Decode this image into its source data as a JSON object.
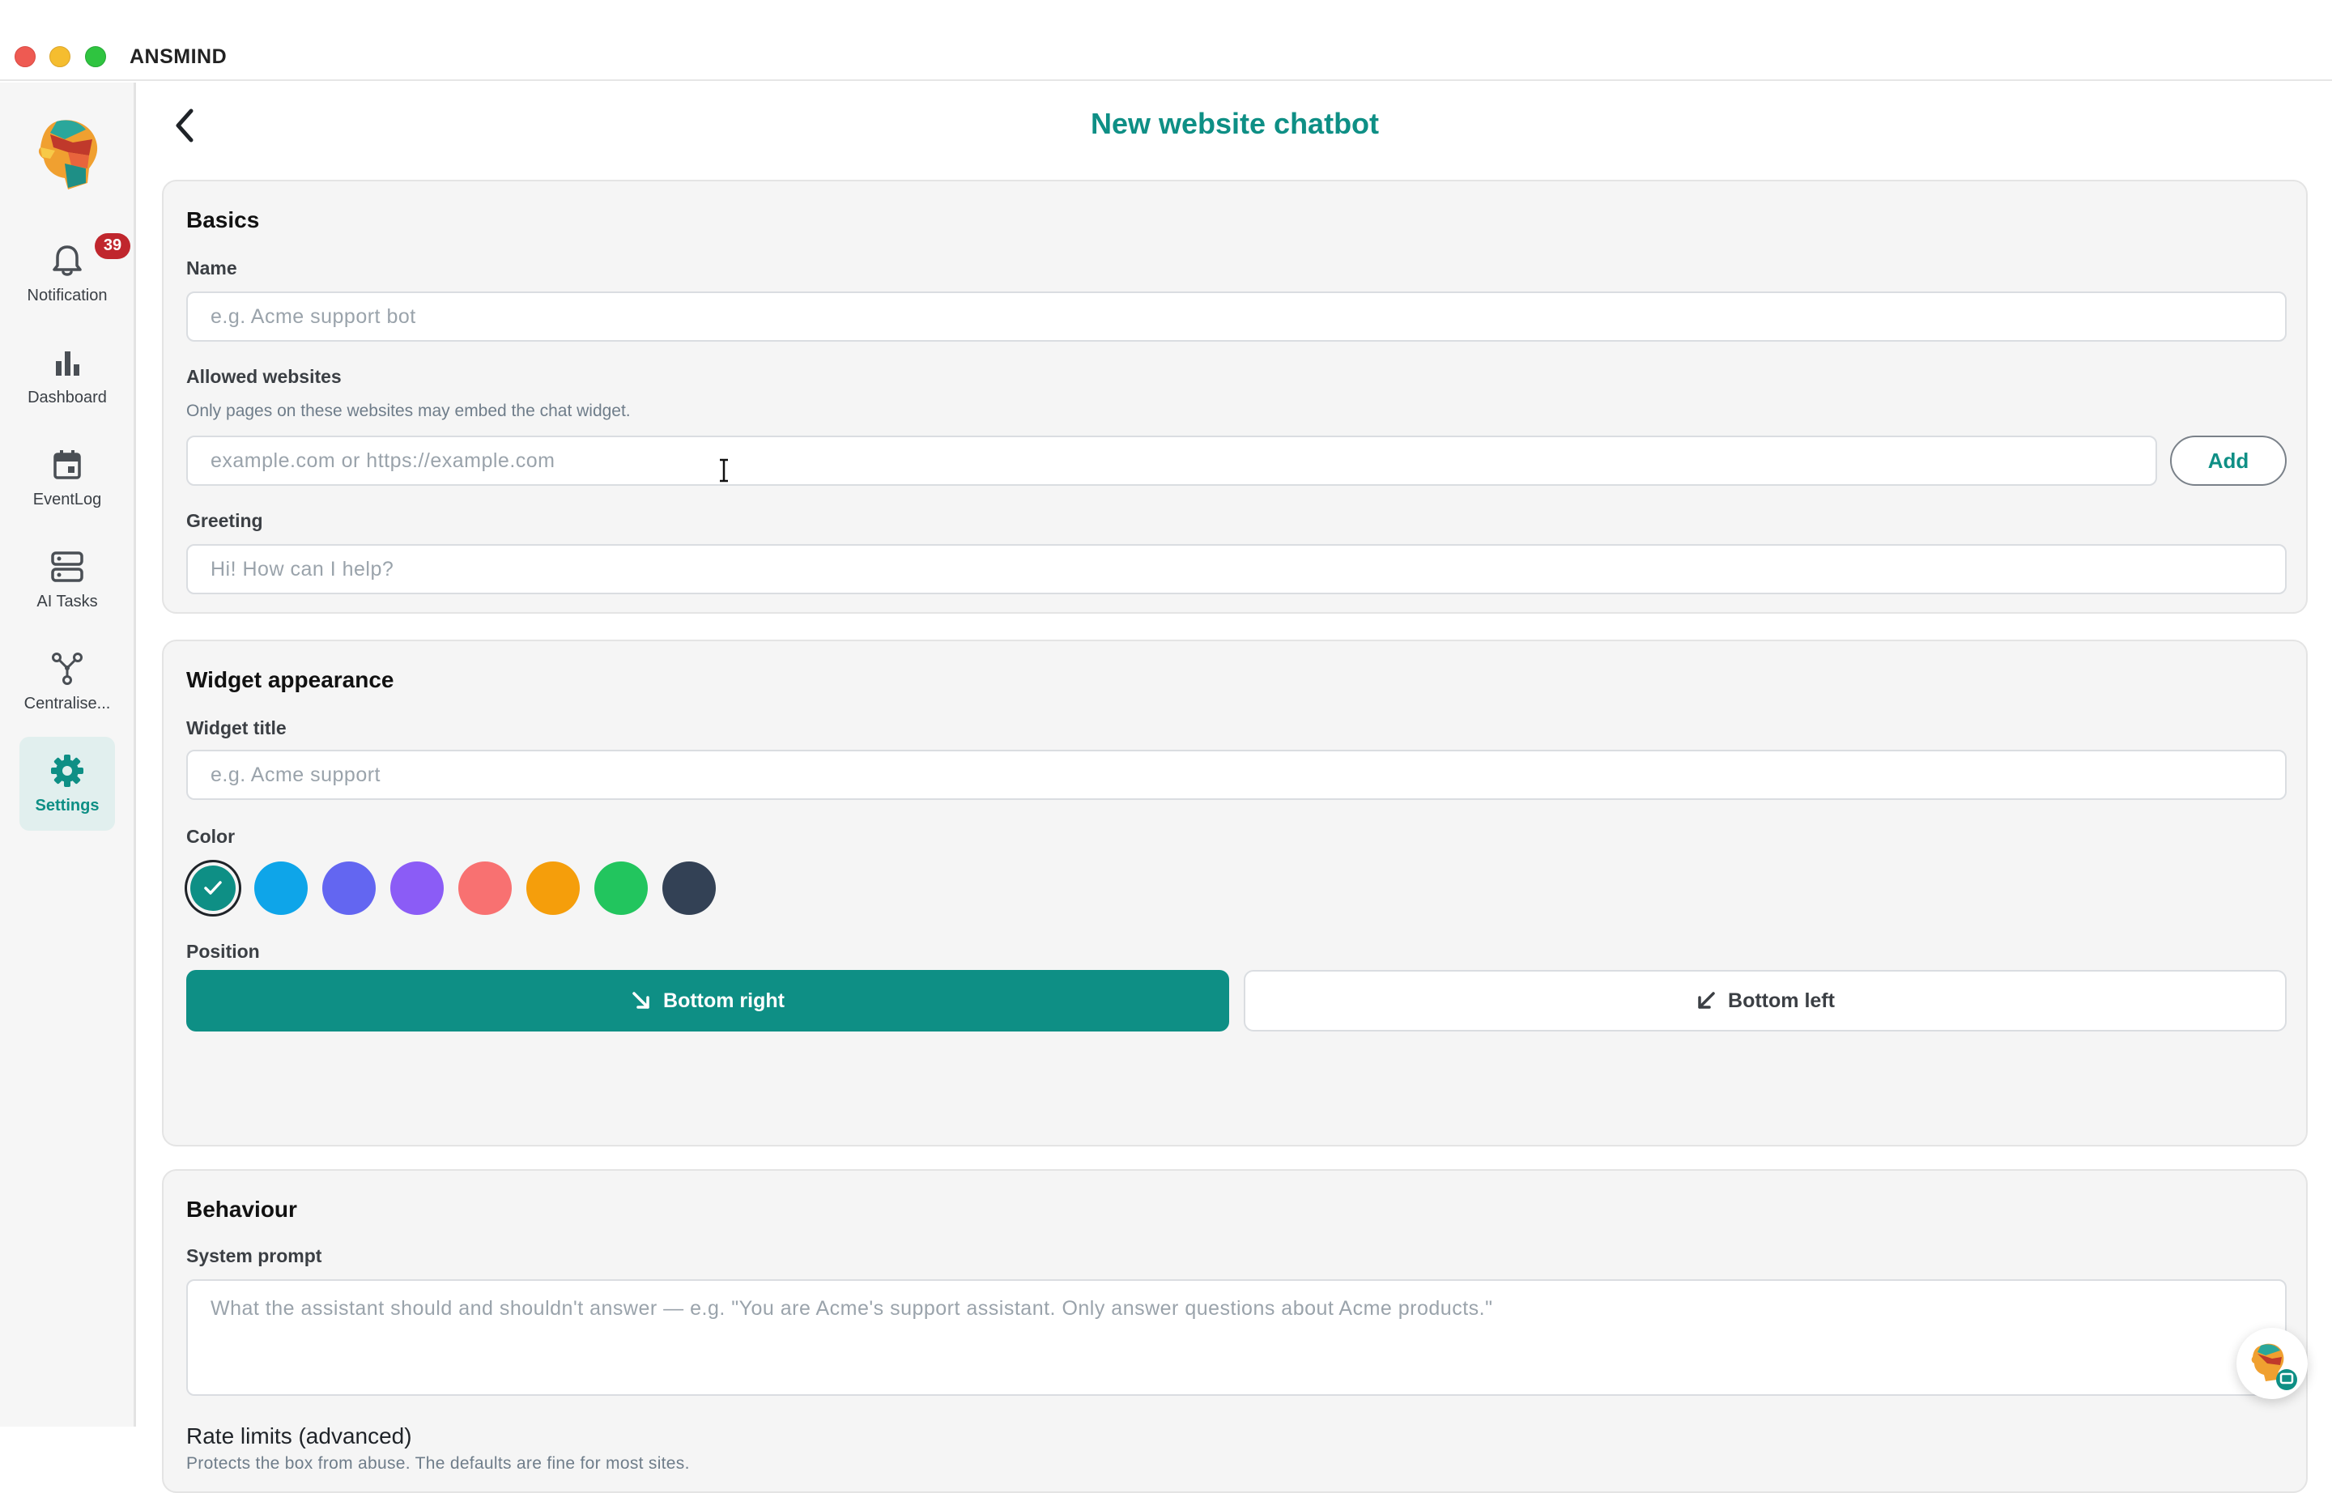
{
  "app": {
    "title": "ANSMIND"
  },
  "sidebar": {
    "items": [
      {
        "label": "Notification",
        "icon": "bell-icon",
        "badge": "39"
      },
      {
        "label": "Dashboard",
        "icon": "bar-chart-icon"
      },
      {
        "label": "EventLog",
        "icon": "calendar-icon"
      },
      {
        "label": "AI Tasks",
        "icon": "server-icon"
      },
      {
        "label": "Centralise...",
        "icon": "network-icon"
      },
      {
        "label": "Settings",
        "icon": "gear-icon",
        "active": true
      }
    ]
  },
  "page": {
    "title": "New website chatbot"
  },
  "basics": {
    "title": "Basics",
    "name_label": "Name",
    "name_placeholder": "e.g. Acme support bot",
    "name_value": "",
    "websites_label": "Allowed websites",
    "websites_help": "Only pages on these websites may embed the chat widget.",
    "websites_placeholder": "example.com or https://example.com",
    "websites_value": "",
    "add_label": "Add",
    "greeting_label": "Greeting",
    "greeting_placeholder": "Hi! How can I help?",
    "greeting_value": ""
  },
  "appearance": {
    "title": "Widget appearance",
    "widget_title_label": "Widget title",
    "widget_title_placeholder": "e.g. Acme support",
    "widget_title_value": "",
    "color_label": "Color",
    "colors": [
      "#0e8f85",
      "#0ea5e9",
      "#6366f1",
      "#8b5cf6",
      "#f87171",
      "#f59e0b",
      "#22c55e",
      "#334155"
    ],
    "selected_color_index": 0,
    "position_label": "Position",
    "positions": [
      {
        "label": "Bottom right",
        "icon": "arrow-down-right-icon",
        "selected": true
      },
      {
        "label": "Bottom left",
        "icon": "arrow-down-left-icon",
        "selected": false
      }
    ]
  },
  "behaviour": {
    "title": "Behaviour",
    "system_prompt_label": "System prompt",
    "system_prompt_placeholder": "What the assistant should and shouldn't answer — e.g. \"You are Acme's support assistant. Only answer questions about Acme products.\"",
    "system_prompt_value": "",
    "rate_limits_title": "Rate limits (advanced)",
    "rate_limits_help": "Protects the box from abuse. The defaults are fine for most sites."
  },
  "theme": {
    "accent": "#0e8f85",
    "badge": "#c0262d"
  }
}
